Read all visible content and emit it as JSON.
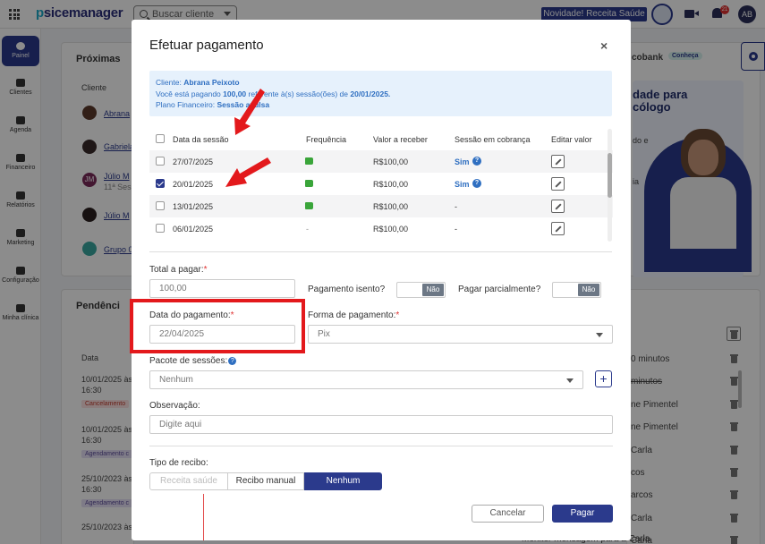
{
  "topbar": {
    "logo_prefix": "p",
    "logo_rest": "sicemanager",
    "search_placeholder": "Buscar cliente",
    "news_label": "Novidade! Receita Saúde",
    "notif_count": "21",
    "avatar_initials": "AB"
  },
  "sidebar": {
    "items": [
      {
        "label": "Painel"
      },
      {
        "label": "Clientes"
      },
      {
        "label": "Agenda"
      },
      {
        "label": "Financeiro"
      },
      {
        "label": "Relatórios"
      },
      {
        "label": "Marketing"
      },
      {
        "label": "Configuração"
      },
      {
        "label": "Minha clínica"
      }
    ]
  },
  "background": {
    "proximas_title": "Próximas",
    "cliente_header": "Cliente",
    "clients": [
      "Abrana",
      "Gabriela",
      "Júlio M",
      "11ª Ses",
      "Júlio M",
      "Grupo 0"
    ],
    "jm_initials": "JM",
    "pendencias_title": "Pendênci",
    "data_header": "Data",
    "pend_rows": [
      {
        "date": "10/01/2025 às",
        "time": "16:30",
        "tag": "Cancelamento"
      },
      {
        "date": "10/01/2025 às",
        "time": "16:30",
        "tag": "Agendamento c"
      },
      {
        "date": "25/10/2023 às",
        "time": "16:30",
        "tag": "Agendamento c"
      },
      {
        "date": "25/10/2023 às",
        "time": ""
      }
    ],
    "cobank": "cobank",
    "conheca": "Conheça",
    "promo_line1": "dade para",
    "promo_line2": "cólogo",
    "promo_line3": "do e",
    "promo_line4": "ia",
    "right_list": [
      "0 minutos",
      "minutos",
      "ne Pimentel",
      "ne Pimentel",
      "Carla",
      "cos",
      "arcos",
      "Carla",
      "Carla"
    ],
    "right_bottom": "Monitor mensagem para a Carla"
  },
  "modal": {
    "title": "Efetuar pagamento",
    "close": "×",
    "info": {
      "client_label": "Cliente: ",
      "client_name": "Abrana Peixoto",
      "paying_prefix": "Você está pagando ",
      "amount": "100,00",
      "paying_mid": " referente à(s) sessão(ões) de ",
      "session_date": "20/01/2025.",
      "plan_label": "Plano Financeiro: ",
      "plan_name": "Sessão avulsa"
    },
    "table": {
      "headers": [
        "Data da sessão",
        "Frequência",
        "Valor a receber",
        "Sessão em cobrança",
        "Editar valor"
      ],
      "rows": [
        {
          "date": "27/07/2025",
          "checked": false,
          "freq": "thumb",
          "value": "R$100,00",
          "cobranca": "Sim"
        },
        {
          "date": "20/01/2025",
          "checked": true,
          "freq": "thumb",
          "value": "R$100,00",
          "cobranca": "Sim"
        },
        {
          "date": "13/01/2025",
          "checked": false,
          "freq": "thumb",
          "value": "R$100,00",
          "cobranca": "-"
        },
        {
          "date": "06/01/2025",
          "checked": false,
          "freq": "-",
          "value": "R$100,00",
          "cobranca": "-"
        }
      ]
    },
    "total_label": "Total a pagar:",
    "total_value": "100,00",
    "isento_label": "Pagamento isento?",
    "isento_toggle": "Não",
    "parcial_label": "Pagar parcialmente?",
    "parcial_toggle": "Não",
    "data_pag_label": "Data do pagamento:",
    "data_pag_value": "22/04/2025",
    "forma_label": "Forma de pagamento:",
    "forma_value": "Pix",
    "pacote_label": "Pacote de sessões:",
    "pacote_value": "Nenhum",
    "obs_label": "Observação:",
    "obs_placeholder": "Digite aqui",
    "recibo_label": "Tipo de recibo:",
    "recibo_options": [
      "Receita saúde",
      "Recibo manual",
      "Nenhum"
    ],
    "cancel_label": "Cancelar",
    "pay_label": "Pagar",
    "required_mark": "*",
    "question_mark": "?"
  },
  "colors": {
    "brand": "#2b3a8c",
    "accent": "#2f6fc1",
    "highlight": "#e3191c"
  }
}
